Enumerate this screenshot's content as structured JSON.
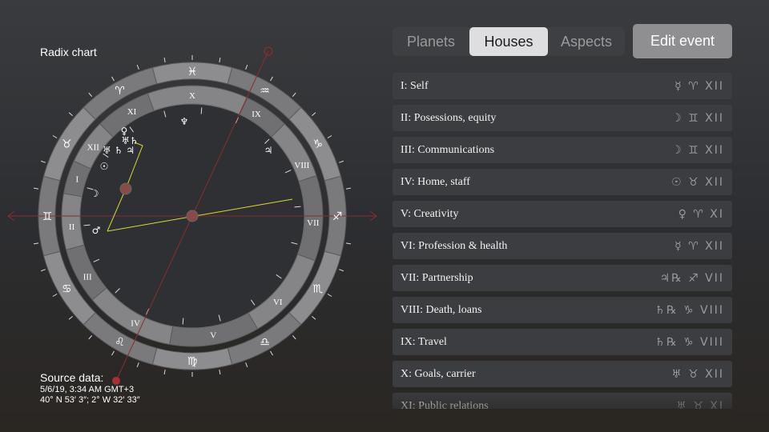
{
  "chart": {
    "title": "Radix chart",
    "zodiac": [
      "♓",
      "♒",
      "♑",
      "♐",
      "♏",
      "♎",
      "♍",
      "♌",
      "♋",
      "♊",
      "♉",
      "♈"
    ],
    "houses": [
      "X",
      "IX",
      "VIII",
      "VII",
      "VI",
      "V",
      "IV",
      "III",
      "II",
      "I",
      "XII",
      "XI"
    ],
    "planets": [
      {
        "glyph": "♆"
      },
      {
        "glyph": "♅ ♄ ♃"
      },
      {
        "glyph": "♃"
      },
      {
        "glyph": "♀"
      },
      {
        "glyph": "♅♄"
      },
      {
        "glyph": "☉"
      },
      {
        "glyph": "☽"
      },
      {
        "glyph": "♂"
      }
    ],
    "colors": {
      "outer": "#7a7a7c",
      "outerAlt": "#8d8d8f",
      "inner": "#858587",
      "innerAlt": "#707072",
      "axis": "#8b2d2d",
      "aspect": "#d8d83a"
    }
  },
  "source": {
    "header": "Source data:",
    "datetime": "5/6/19, 3:34 AM GMT+3",
    "coords": "40° N 53′ 3″; 2° W 32′ 33″"
  },
  "tabs": [
    {
      "label": "Planets",
      "active": false
    },
    {
      "label": "Houses",
      "active": true
    },
    {
      "label": "Aspects",
      "active": false
    }
  ],
  "edit_event": "Edit event",
  "houses": [
    {
      "label": "I: Self",
      "signs": "☿ ♈ XII"
    },
    {
      "label": "II: Posessions, equity",
      "signs": "☽ ♊ XII"
    },
    {
      "label": "III: Communications",
      "signs": "☽ ♊ XII"
    },
    {
      "label": "IV: Home, staff",
      "signs": "☉ ♉ XII"
    },
    {
      "label": "V: Creativity",
      "signs": "♀ ♈ XI"
    },
    {
      "label": "VI: Profession & health",
      "signs": "☿ ♈ XII"
    },
    {
      "label": "VII: Partnership",
      "signs": "♃℞ ♐ VII"
    },
    {
      "label": "VIII: Death, loans",
      "signs": "♄℞ ♑ VIII"
    },
    {
      "label": "IX: Travel",
      "signs": "♄℞ ♑ VIII"
    },
    {
      "label": "X: Goals, carrier",
      "signs": "♅ ♉ XII"
    },
    {
      "label": "XI: Public relations",
      "signs": "♅ ♉ XI"
    }
  ]
}
